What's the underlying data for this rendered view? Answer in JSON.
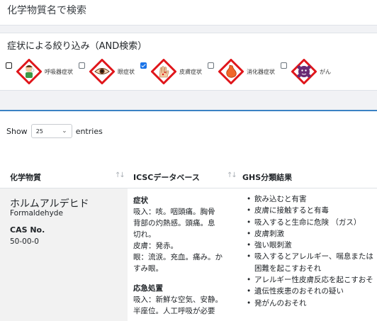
{
  "search": {
    "placeholder": "化学物質名で検索"
  },
  "filter": {
    "title": "症状による絞り込み（AND検索）",
    "items": [
      {
        "label": "呼吸器症状",
        "checked": false,
        "icon": "respiratory-pictogram-icon"
      },
      {
        "label": "眼症状",
        "checked": false,
        "icon": "eye-pictogram-icon"
      },
      {
        "label": "皮膚症状",
        "checked": true,
        "icon": "skin-pictogram-icon"
      },
      {
        "label": "消化器症状",
        "checked": false,
        "icon": "digestive-pictogram-icon"
      },
      {
        "label": "がん",
        "checked": false,
        "icon": "cancer-pictogram-icon"
      }
    ]
  },
  "table": {
    "show_prefix": "Show",
    "show_value": "25",
    "show_suffix": "entries",
    "headers": [
      "化学物質",
      "ICSCデータベース",
      "GHS分類結果"
    ],
    "row": {
      "name": "ホルムアルデヒド",
      "name_en": "Formaldehyde",
      "cas_label": "CAS No.",
      "cas": "50-00-0",
      "icsc": {
        "symptoms_title": "症状",
        "symptoms": [
          "吸入：咳。咽頭痛。胸骨",
          "背部の灼熱感。頭痛。息",
          "切れ。",
          "皮膚：発赤。",
          "眼：流涙。充血。痛み。か",
          "すみ眼。"
        ],
        "first_aid_title": "応急処置",
        "first_aid": [
          "吸入：新鮮な空気、安静。",
          "半座位。人工呼吸が必要"
        ]
      },
      "ghs": [
        "飲み込むと有害",
        "皮膚に接触すると有毒",
        "吸入すると生命に危険 （ガス）",
        "皮膚刺激",
        "強い眼刺激",
        "吸入するとアレルギー、喘息または",
        "困難を起こすおそれ",
        "アレルギー性皮膚反応を起こすおそ",
        "遺伝性疾患のおそれの疑い",
        "発がんのおそれ"
      ]
    }
  },
  "colors": {
    "accent": "#3b82c4",
    "hazard_red": "#e0161b",
    "checkbox_on": "#1a73e8"
  }
}
